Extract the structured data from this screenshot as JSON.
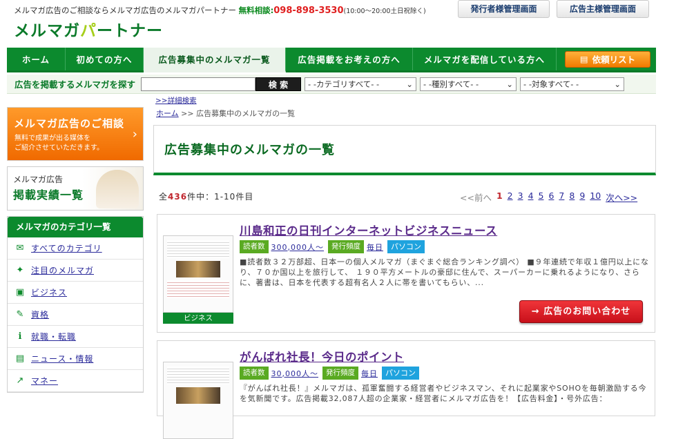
{
  "header": {
    "tagline": "メルマガ広告のご相談ならメルマガ広告のメルマガパートナー",
    "free_consult": "無料相談:",
    "phone": "098-898-3530",
    "hours": "(10:00〜20:00土日祝除く)",
    "logo_part1": "メルマガ",
    "logo_part2": "パ",
    "logo_part3": "ートナー",
    "publisher_button": "発行者様管理画面",
    "advertiser_button": "広告主様管理画面"
  },
  "nav": {
    "items": [
      "ホーム",
      "初めての方へ",
      "広告募集中のメルマガ一覧",
      "広告掲載をお考えの方へ",
      "メルマガを配信している方へ"
    ],
    "request_list": "依頼リスト"
  },
  "search": {
    "label": "広告を掲載するメルマガを探す",
    "input_value": "",
    "button": "検 索",
    "category": "- -カテゴリすべて- -",
    "type": "- -種別すべて- -",
    "target": "- -対象すべて- -",
    "advanced": ">>詳細検索"
  },
  "sidebar": {
    "banner1_title": "メルマガ広告のご相談",
    "banner1_text1": "無料で成果が出る媒体を",
    "banner1_text2": "ご紹介させていただきます。",
    "banner2_small": "メルマガ広告",
    "banner2_big": "掲載実績一覧",
    "category_title": "メルマガのカテゴリ一覧",
    "categories": [
      "すべてのカテゴリ",
      "注目のメルマガ",
      "ビジネス",
      "資格",
      "就職・転職",
      "ニュース・情報",
      "マネー"
    ]
  },
  "breadcrumb": {
    "home": "ホーム",
    "sep": ">>",
    "current": "広告募集中のメルマガの一覧"
  },
  "main": {
    "title": "広告募集中のメルマガの一覧",
    "count_prefix": "全",
    "count_num": "436",
    "count_suffix": "件中：1-10件目",
    "pager_prev": "<<前へ",
    "pager_current": "1",
    "pager_pages": [
      "2",
      "3",
      "4",
      "5",
      "6",
      "7",
      "8",
      "9",
      "10"
    ],
    "pager_next": "次へ>>"
  },
  "listings": [
    {
      "title": "川島和正の日刊インターネットビジネスニュース",
      "readers_label": "読者数",
      "readers": "300,000人〜",
      "freq_label": "発行頻度",
      "freq": "毎日",
      "device": "パソコン",
      "category": "ビジネス",
      "description": "■読者数３２万部超、日本一の個人メルマガ（まぐまぐ総合ランキング調べ） ■９年連続で年収１億円以上になり、７０か国以上を旅行して、 １９０平方メートルの豪邸に住んで、スーパーカーに乗れるようになり、さらに、著書は、日本を代表する超有名人２人に帯を書いてもらい、...",
      "contact_button": "広告のお問い合わせ"
    },
    {
      "title": "がんばれ社長！今日のポイント",
      "readers_label": "読者数",
      "readers": "30,000人〜",
      "freq_label": "発行頻度",
      "freq": "毎日",
      "device": "パソコン",
      "description": "『がんばれ社長！』メルマガは、孤軍奮闘する経営者やビジネスマン、それに起業家やSOHOを毎朝激励する今を気新聞です。広告掲載32,087人超の企業家・経営者にメルマガ広告を！【広告料金】・号外広告："
    }
  ]
}
